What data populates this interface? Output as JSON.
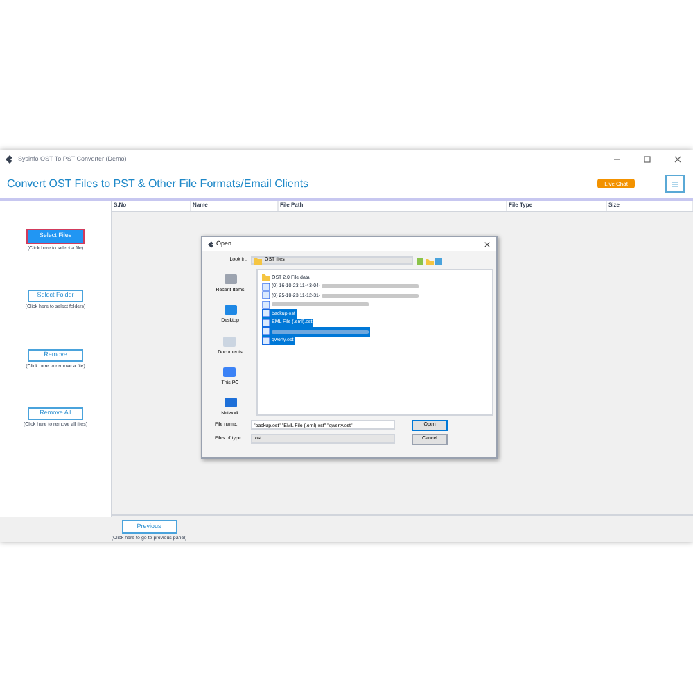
{
  "window": {
    "title": "Sysinfo OST To PST Converter (Demo)"
  },
  "header": {
    "title": "Convert OST Files to PST & Other File Formats/Email Clients",
    "live_chat": "Live Chat"
  },
  "actions": [
    {
      "label": "Select Files",
      "hint": "(Click here to select a file)",
      "selected": true
    },
    {
      "label": "Select Folder",
      "hint": "(Click here to select folders)",
      "selected": false
    },
    {
      "label": "Remove",
      "hint": "(Click here to remove a file)",
      "selected": false
    },
    {
      "label": "Remove All",
      "hint": "(Click here to remove all files)",
      "selected": false
    }
  ],
  "table": {
    "columns": [
      "S.No",
      "Name",
      "File Path",
      "File Type",
      "Size"
    ]
  },
  "footer": {
    "button": "Previous",
    "hint": "(Click here to go to previous panel)"
  },
  "dialog": {
    "title": "Open",
    "look_in_label": "Look in:",
    "look_in": "OST files",
    "places": [
      "Recent Items",
      "Desktop",
      "Documents",
      "This PC",
      "Network"
    ],
    "items": [
      {
        "kind": "folder",
        "label": "OST 2.0 File data",
        "redacted": false,
        "selected": false
      },
      {
        "kind": "file",
        "label": "(0) 16-10-23 11-43-04-",
        "redacted": true,
        "selected": false
      },
      {
        "kind": "file",
        "label": "(0) 25-10-23 11-12-31-",
        "redacted": true,
        "selected": false
      },
      {
        "kind": "file",
        "redacted": true,
        "selected": false
      },
      {
        "kind": "file",
        "label": "backup.ost",
        "redacted": false,
        "selected": true
      },
      {
        "kind": "file",
        "label": "EML File (.eml).ost",
        "redacted": false,
        "selected": true
      },
      {
        "kind": "file",
        "redacted": true,
        "selected": true
      },
      {
        "kind": "file",
        "label": "qwerty.ost",
        "redacted": false,
        "selected": true
      }
    ],
    "file_name_label": "File name:",
    "file_name": "\"backup.ost\" \"EML File (.eml).ost\" \"qwerty.ost\"",
    "file_type_label": "Files of type:",
    "file_type": ".ost",
    "open": "Open",
    "cancel": "Cancel"
  }
}
